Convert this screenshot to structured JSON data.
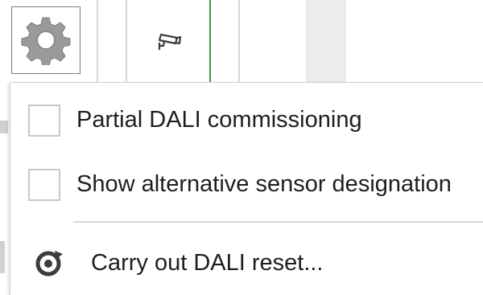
{
  "toolbar": {
    "settings_icon": "gear-icon",
    "camera_icon": "camera-icon"
  },
  "menu": {
    "items": [
      {
        "label": "Partial DALI commissioning",
        "checked": false,
        "type": "checkbox"
      },
      {
        "label": "Show alternative sensor designation",
        "checked": false,
        "type": "checkbox"
      },
      {
        "label": "Carry out DALI reset...",
        "icon": "reset-icon",
        "type": "action"
      }
    ]
  },
  "colors": {
    "accent_green": "#3a9a3a",
    "icon_dark": "#3c3c3c",
    "gear_grey": "#9a9a9a"
  }
}
